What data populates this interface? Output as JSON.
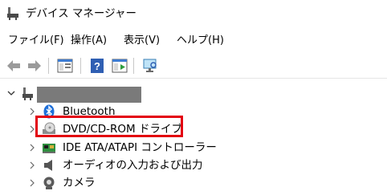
{
  "window": {
    "title": "デバイス マネージャー"
  },
  "menu": [
    "ファイル(F)",
    "操作(A)",
    "表示(V)",
    "ヘルプ(H)"
  ],
  "toolbar": {
    "buttons": [
      "back-arrow-icon",
      "forward-arrow-icon",
      "properties-panel-icon",
      "help-icon",
      "run-panel-icon",
      "monitor-scan-icon"
    ]
  },
  "tree": {
    "root_label": "",
    "items": [
      {
        "label": "Bluetooth",
        "icon": "bluetooth-icon"
      },
      {
        "label": "DVD/CD-ROM ドライブ",
        "icon": "optical-drive-icon",
        "highlighted": true
      },
      {
        "label": "IDE ATA/ATAPI コントローラー",
        "icon": "ide-controller-icon"
      },
      {
        "label": "オーディオの入力および出力",
        "icon": "speaker-icon"
      },
      {
        "label": "カメラ",
        "icon": "camera-icon"
      }
    ]
  },
  "colors": {
    "highlight": "#e3000f",
    "redaction": "#7a7a7a",
    "bluetooth": "#1e6fd9"
  }
}
